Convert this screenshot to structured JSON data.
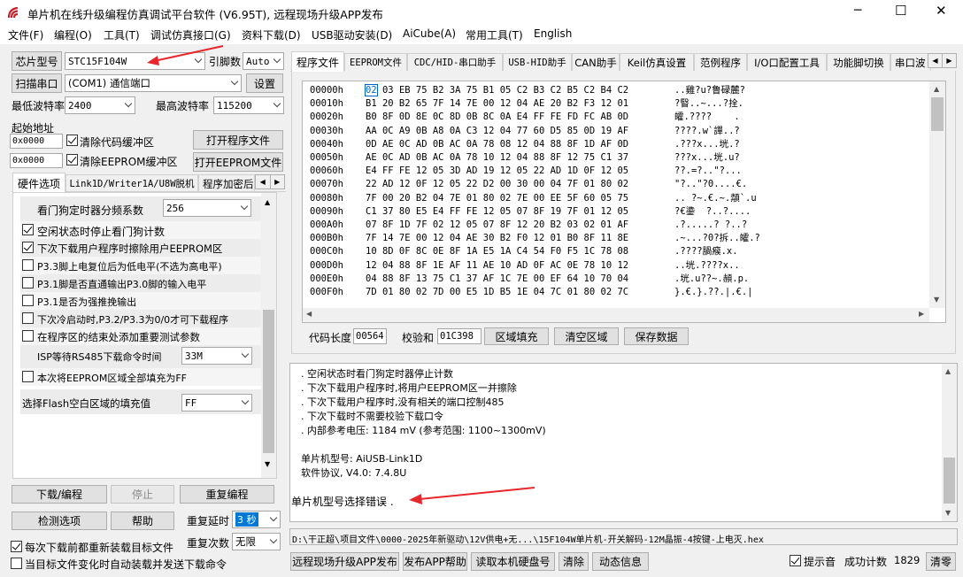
{
  "window": {
    "title": "单片机在线升级编程仿真调试平台软件 (V6.95T), 远程现场升级APP发布",
    "controls": [
      "─",
      "☐",
      "✕"
    ]
  },
  "menu": [
    "文件(F)",
    "编程(O)",
    "工具(T)",
    "调试仿真接口(G)",
    "资料下载(D)",
    "USB驱动安装(D)",
    "AiCube(A)",
    "常用工具(T)",
    "English"
  ],
  "left": {
    "chip_type_btn": "芯片型号",
    "chip_type_value": "STC15F104W",
    "pin_count_label": "引脚数",
    "pin_count_value": "Auto",
    "scan_port_btn": "扫描串口",
    "port_value": "(COM1) 通信端口",
    "settings_btn": "设置",
    "min_baud_label": "最低波特率",
    "min_baud_value": "2400",
    "max_baud_label": "最高波特率",
    "max_baud_value": "115200",
    "start_addr_label": "起始地址",
    "addr1": "0x0000",
    "clear_code_label": "清除代码缓冲区",
    "open_prog_btn": "打开程序文件",
    "addr2": "0x0000",
    "clear_eeprom_label": "清除EEPROM缓冲区",
    "open_eeprom_btn": "打开EEPROM文件",
    "tabs": [
      "硬件选项",
      "Link1D/Writer1A/U8W脱机",
      "程序加密后"
    ],
    "options": {
      "wdt_label": "看门狗定时器分频系数",
      "wdt_value": "256",
      "items": [
        {
          "label": "空闲状态时停止看门狗计数",
          "checked": true
        },
        {
          "label": "下次下载用户程序时擦除用户EEPROM区",
          "checked": true
        },
        {
          "label": "P3.3脚上电复位后为低电平(不选为高电平)",
          "checked": false
        },
        {
          "label": "P3.1脚是否直通输出P3.0脚的输入电平",
          "checked": false
        },
        {
          "label": "P3.1是否为强推挽输出",
          "checked": false
        },
        {
          "label": "下次冷启动时,P3.2/P3.3为0/0才可下载程序",
          "checked": false
        },
        {
          "label": "在程序区的结束处添加重要测试参数",
          "checked": false
        }
      ],
      "isp_wait_label": "ISP等待RS485下载命令时间",
      "isp_wait_value": "33M",
      "eeprom_fill_label": "本次将EEPROM区域全部填充为FF",
      "flash_fill_label": "选择Flash空白区域的填充值",
      "flash_fill_value": "FF"
    },
    "download_btn": "下载/编程",
    "stop_btn": "停止",
    "reprogram_btn": "重复编程",
    "detect_btn": "检测选项",
    "help_btn": "帮助",
    "repeat_delay_label": "重复延时",
    "repeat_delay_value": "3 秒",
    "repeat_count_label": "重复次数",
    "repeat_count_value": "无限",
    "reload_label": "每次下载前都重新装载目标文件",
    "auto_load_label": "当目标文件变化时自动装载并发送下载命令"
  },
  "right": {
    "tabs": [
      "程序文件",
      "EEPROM文件",
      "CDC/HID-串口助手",
      "USB-HID助手",
      "CAN助手",
      "Keil仿真设置",
      "范例程序",
      "I/O口配置工具",
      "功能脚切换",
      "串口波"
    ],
    "hex": [
      {
        "addr": "00000h",
        "bytes": "02 03 EB 75 B2 3A 75 B1 05 C2 B3 C2 B5 C2 B4 C2",
        "ascii": "..雞?u?鲁碌麓?"
      },
      {
        "addr": "00010h",
        "bytes": "B1 20 B2 65 7F 14 7E 00 12 04 AE 20 B2 F3 12 01",
        "ascii": "?瞖..~...?拴."
      },
      {
        "addr": "00020h",
        "bytes": "B0 8F 0D 8E 0C 8D 0B 8C 0A E4 FF FE FD FC AB 0D",
        "ascii": "皬.????    ."
      },
      {
        "addr": "00030h",
        "bytes": "AA 0C A9 0B A8 0A C3 12 04 77 60 D5 85 0D 19 AF",
        "ascii": "????.w`譂..?"
      },
      {
        "addr": "00040h",
        "bytes": "0D AE 0C AD 0B AC 0A 78 08 12 04 88 8F 1D AF 0D",
        "ascii": ".???x...垙.?"
      },
      {
        "addr": "00050h",
        "bytes": "AE 0C AD 0B AC 0A 78 10 12 04 88 8F 12 75 C1 37",
        "ascii": "???x...垙.u?"
      },
      {
        "addr": "00060h",
        "bytes": "E4 FF FE 12 05 3D AD 19 12 05 22 AD 1D 0F 12 05",
        "ascii": "??.=?..\"?..."
      },
      {
        "addr": "00070h",
        "bytes": "22 AD 12 0F 12 05 22 D2 00 30 00 04 7F 01 80 02",
        "ascii": "\"?..\"?0....€."
      },
      {
        "addr": "00080h",
        "bytes": "7F 00 20 B2 04 7E 01 80 02 7E 00 EE 5F 60 05 75",
        "ascii": ".. ?~.€.~.頮`.u"
      },
      {
        "addr": "00090h",
        "bytes": "C1 37 80 E5 E4 FF FE 12 05 07 8F 19 7F 01 12 05",
        "ascii": "?€鍌  ?..?...."
      },
      {
        "addr": "000A0h",
        "bytes": "07 8F 1D 7F 02 12 05 07 8F 12 20 B2 03 02 01 AF",
        "ascii": ".?.....? ?..?"
      },
      {
        "addr": "000B0h",
        "bytes": "7F 14 7E 00 12 04 AE 30 B2 F0 12 01 B0 8F 11 8E",
        "ascii": ".~...?0?拆..皬.?"
      },
      {
        "addr": "000C0h",
        "bytes": "10 8D 0F 8C 0E 8F 1A E5 1A C4 54 F0 F5 1C 78 08",
        "ascii": ".????腡瘊.x."
      },
      {
        "addr": "000D0h",
        "bytes": "12 04 88 8F 1E AF 11 AE 10 AD 0F AC 0E 78 10 12",
        "ascii": "..垙.????x.."
      },
      {
        "addr": "000E0h",
        "bytes": "04 88 8F 13 75 C1 37 AF 1C 7E 00 EF 64 10 70 04",
        "ascii": ".垙.u??~.頳.p."
      },
      {
        "addr": "000F0h",
        "bytes": "7D 01 80 02 7D 00 E5 1D B5 1E 04 7C 01 80 02 7C",
        "ascii": "}.€.}.??.|.€.|"
      }
    ],
    "code_len_label": "代码长度",
    "code_len_value": "00564",
    "checksum_label": "校验和",
    "checksum_value": "01C398",
    "fill_btn": "区域填充",
    "clear_btn": "清空区域",
    "save_btn": "保存数据",
    "log": [
      ". 空闲状态时看门狗定时器停止计数",
      ". 下次下载用户程序时,将用户EEPROM区一并擦除",
      ". 下次下载用户程序时,没有相关的端口控制485",
      ". 下次下载时不需要校验下载口令",
      ". 内部参考电压: 1184 mV (参考范围: 1100~1300mV)",
      "",
      "单片机型号: AiUSB-Link1D",
      "软件协议, V4.0: 7.4.8U"
    ],
    "error_msg": "单片机型号选择错误 .",
    "file_path": "D:\\干正超\\项目文件\\0000-2025年新驱动\\12V供电+无...\\15F104W单片机-开关解码-12M晶振-4按键-上电灭.hex",
    "remote_btn": "远程现场升级APP发布",
    "app_help_btn": "发布APP帮助",
    "read_disk_btn": "读取本机硬盘号",
    "clear_log_btn": "清除",
    "dynamic_btn": "动态信息",
    "sound_label": "提示音",
    "success_label": "成功计数",
    "success_value": "1829",
    "clear_count_btn": "清零"
  },
  "colors": {
    "arrow": "#e8272c",
    "hex_sel": "#0066cc"
  }
}
